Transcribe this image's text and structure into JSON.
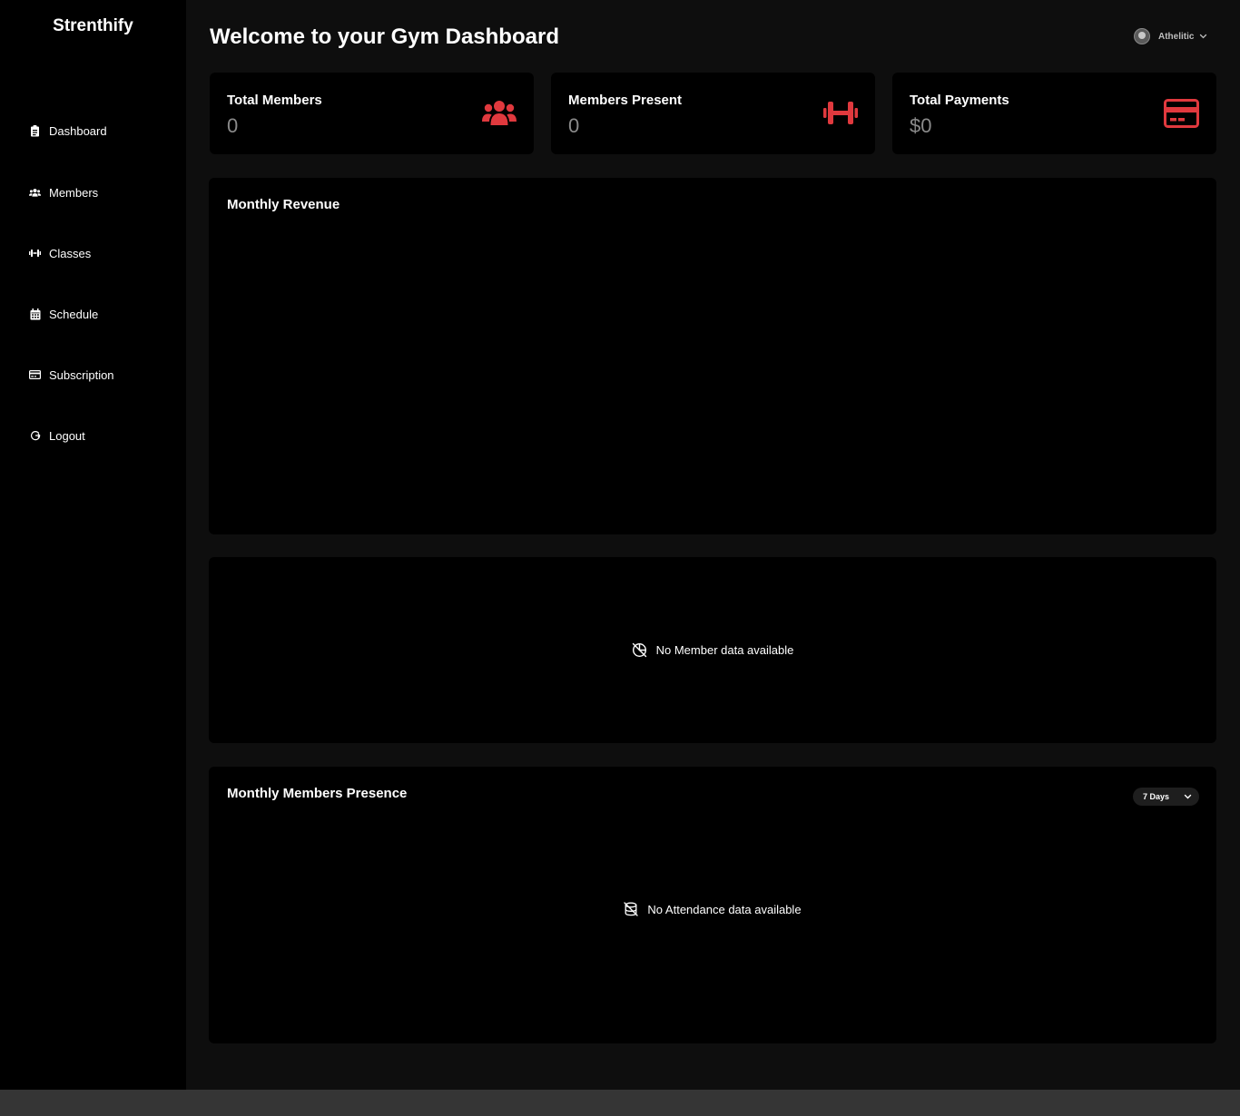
{
  "sidebar": {
    "brand": "Strenthify",
    "items": [
      {
        "label": "Dashboard",
        "icon": "clipboard-icon"
      },
      {
        "label": "Members",
        "icon": "users-icon"
      },
      {
        "label": "Classes",
        "icon": "dumbbell-icon"
      },
      {
        "label": "Schedule",
        "icon": "calendar-icon"
      },
      {
        "label": "Subscription",
        "icon": "credit-card-icon"
      },
      {
        "label": "Logout",
        "icon": "logout-icon"
      }
    ]
  },
  "header": {
    "title": "Welcome to your Gym Dashboard",
    "user_name": "Athelitic"
  },
  "stats": [
    {
      "label": "Total Members",
      "value": "0",
      "icon": "users-icon"
    },
    {
      "label": "Members Present",
      "value": "0",
      "icon": "dumbbell-icon"
    },
    {
      "label": "Total Payments",
      "value": "$0",
      "icon": "credit-card-icon"
    }
  ],
  "revenue_panel": {
    "title": "Monthly Revenue"
  },
  "member_panel": {
    "empty_text": "No Member data available",
    "icon": "chart-off-icon"
  },
  "presence_panel": {
    "title": "Monthly Members Presence",
    "range_value": "7 Days",
    "empty_text": "No Attendance data available",
    "icon": "database-off-icon"
  },
  "colors": {
    "accent": "#e0393e",
    "background": "#0e0e0e",
    "sidebar": "#000000",
    "card": "#000000"
  }
}
